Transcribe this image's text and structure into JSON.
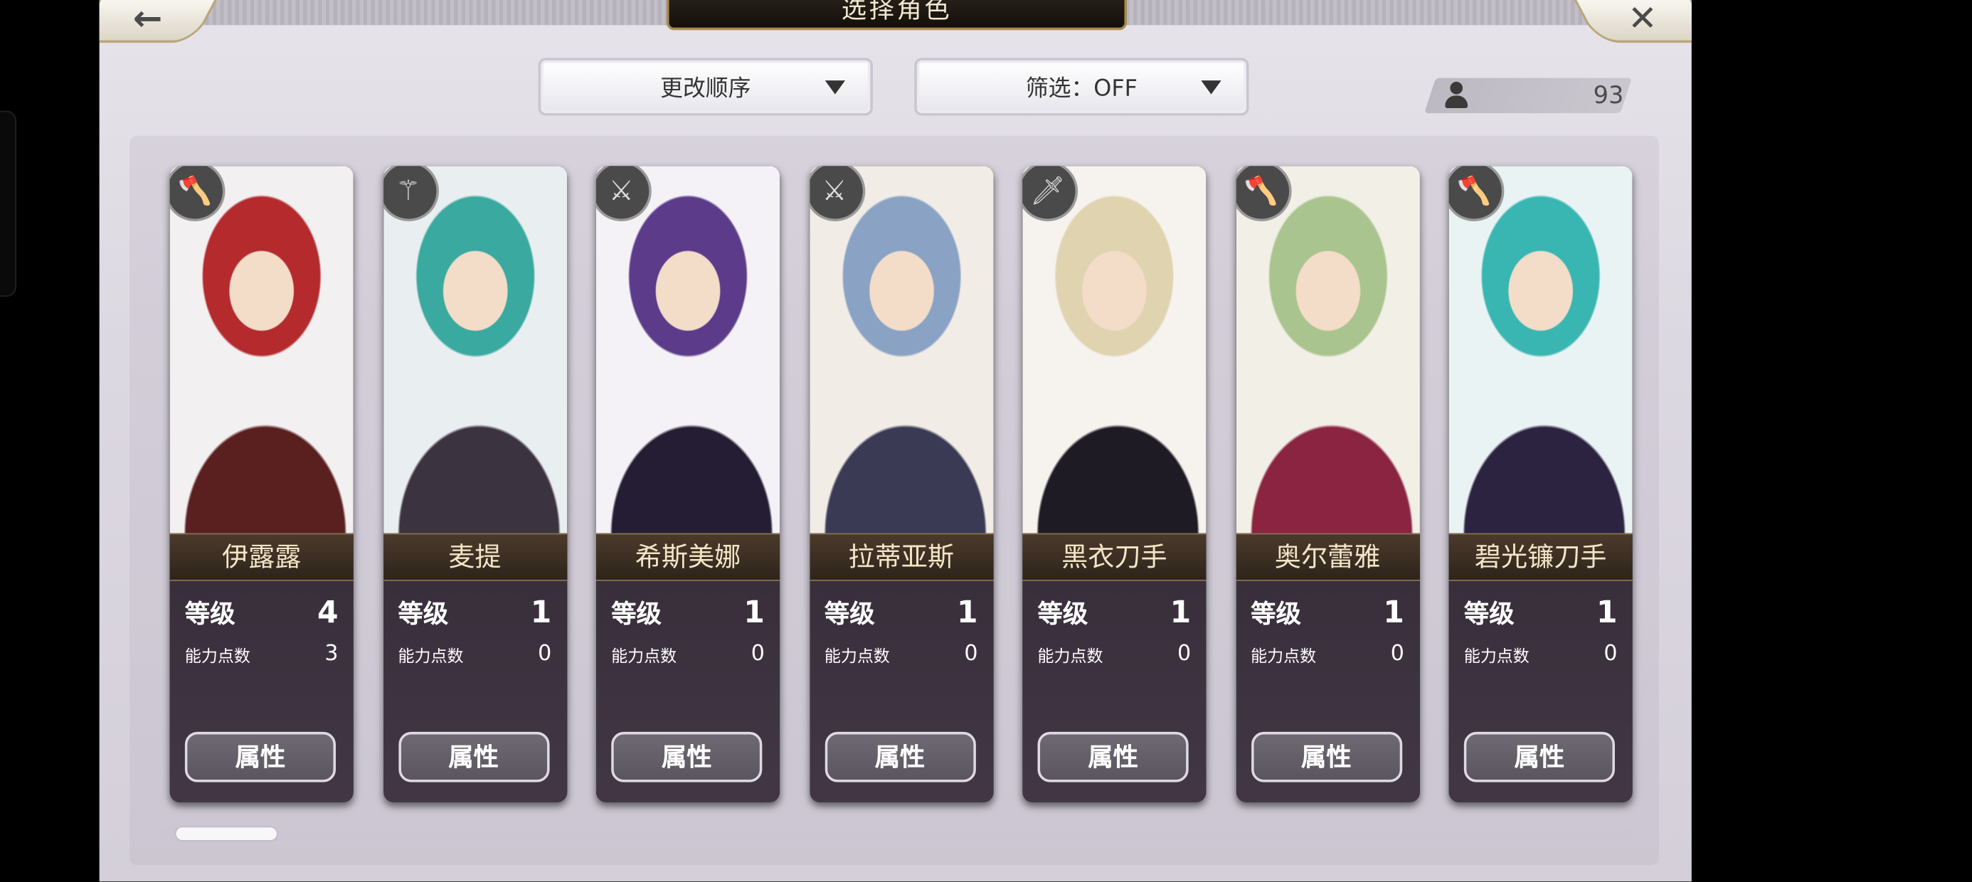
{
  "header": {
    "title": "选择角色",
    "back_symbol": "←",
    "close_symbol": "✕"
  },
  "controls": {
    "sort_label": "更改顺序",
    "filter_label": "筛选：OFF",
    "count": "93"
  },
  "labels": {
    "level": "等级",
    "points": "能力点数",
    "attribute_button": "属性"
  },
  "characters": [
    {
      "name": "伊露露",
      "level": "4",
      "points": "3",
      "weapon_icon": "axe-icon",
      "colors": [
        "#f2f0f1",
        "#b52a2d",
        "#5a2020"
      ]
    },
    {
      "name": "麦提",
      "level": "1",
      "points": "0",
      "weapon_icon": "staff-icon",
      "colors": [
        "#e9eef0",
        "#3aa9a0",
        "#3b3440"
      ]
    },
    {
      "name": "希斯美娜",
      "level": "1",
      "points": "0",
      "weapon_icon": "sword-icon",
      "colors": [
        "#f4f2f7",
        "#5b3b8a",
        "#251d33"
      ]
    },
    {
      "name": "拉蒂亚斯",
      "level": "1",
      "points": "0",
      "weapon_icon": "sword-icon",
      "colors": [
        "#f1ede6",
        "#8aa3c4",
        "#3b3a55"
      ]
    },
    {
      "name": "黑衣刀手",
      "level": "1",
      "points": "0",
      "weapon_icon": "katana-icon",
      "colors": [
        "#f6f3ee",
        "#e0d3b0",
        "#1f1b24"
      ]
    },
    {
      "name": "奥尔蕾雅",
      "level": "1",
      "points": "0",
      "weapon_icon": "axe-icon",
      "colors": [
        "#f2efe6",
        "#a9c48e",
        "#8a2440"
      ]
    },
    {
      "name": "碧光镰刀手",
      "level": "1",
      "points": "0",
      "weapon_icon": "axe-icon",
      "colors": [
        "#eaf3f4",
        "#39b6b2",
        "#2b2340"
      ]
    }
  ]
}
